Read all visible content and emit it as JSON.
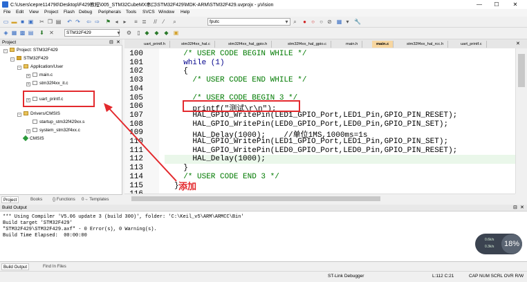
{
  "window": {
    "title": "C:\\Users\\cepre114790\\Desktop\\F429教程\\005_STM32CubeMX串口\\STM32F429\\MDK-ARM\\STM32F429.uvprojx - µVision",
    "min": "—",
    "max": "☐",
    "close": "✕"
  },
  "menu": [
    "File",
    "Edit",
    "View",
    "Project",
    "Flash",
    "Debug",
    "Peripherals",
    "Tools",
    "SVCS",
    "Window",
    "Help"
  ],
  "toolbar": {
    "find_value": "fputc",
    "target_value": "STM32F429"
  },
  "project": {
    "header": "Project",
    "root": "Project: STM32F429",
    "target": "STM32F429",
    "group_app": "Application/User",
    "files_app": [
      "main.c",
      "stm32f4xx_it.c"
    ],
    "added_file": "uart_printf.c",
    "group_drivers": "Drivers/CMSIS",
    "files_drivers": [
      "startup_stm32f429xx.s",
      "system_stm32f4xx.c"
    ],
    "cmsis": "CMSIS",
    "tabs": [
      "Project",
      "Books",
      "{} Functions",
      "0→ Templates"
    ]
  },
  "editor": {
    "tabs": [
      "uart_printf.h",
      "stm32f4xx_hal.c",
      "stm32f4xx_hal_gpio.h",
      "stm32f4xx_hal_gpio.c",
      "main.h",
      "main.c",
      "stm32f4xx_hal_rcc.h",
      "uart_printf.c"
    ],
    "active_tab": "main.c",
    "lines": [
      {
        "n": "100",
        "text": "  /* USER CODE BEGIN WHILE */",
        "cls": "cmt"
      },
      {
        "n": "101",
        "text": "  while (1)",
        "cls": "kw"
      },
      {
        "n": "102",
        "text": "  {",
        "cls": "fn"
      },
      {
        "n": "103",
        "text": "    /* USER CODE END WHILE */",
        "cls": "cmt"
      },
      {
        "n": "104",
        "text": "",
        "cls": "fn"
      },
      {
        "n": "105",
        "text": "    /* USER CODE BEGIN 3 */",
        "cls": "cmt"
      },
      {
        "n": "106",
        "text": "    printf(\"测试\\r\\n\");",
        "cls": "fn"
      },
      {
        "n": "107",
        "text": "    HAL_GPIO_WritePin(LED1_GPIO_Port,LED1_Pin,GPIO_PIN_RESET);",
        "cls": "fn"
      },
      {
        "n": "108",
        "text": "    HAL_GPIO_WritePin(LED0_GPIO_Port,LED0_Pin,GPIO_PIN_SET);",
        "cls": "fn"
      },
      {
        "n": "109",
        "text": "    HAL_Delay(1000);    //单位1MS,1000ms=1s",
        "cls": "fn"
      },
      {
        "n": "110",
        "text": "    HAL_GPIO_WritePin(LED1_GPIO_Port,LED1_Pin,GPIO_PIN_SET);",
        "cls": "fn"
      },
      {
        "n": "111",
        "text": "    HAL_GPIO_WritePin(LED0_GPIO_Port,LED0_Pin,GPIO_PIN_RESET);",
        "cls": "fn"
      },
      {
        "n": "112",
        "text": "    HAL_Delay(1000);",
        "cls": "fn"
      },
      {
        "n": "113",
        "text": "  }",
        "cls": "fn"
      },
      {
        "n": "114",
        "text": "  /* USER CODE END 3 */",
        "cls": "cmt"
      },
      {
        "n": "115",
        "text": "}",
        "cls": "fn"
      },
      {
        "n": "116",
        "text": "",
        "cls": "fn"
      }
    ],
    "annotation": "添加"
  },
  "build": {
    "header": "Build Output",
    "lines": [
      "*** Using Compiler 'V5.06 update 3 (build 300)', folder: 'C:\\Keil_v5\\ARM\\ARMCC\\Bin'",
      "Build target 'STM32F429'",
      "\"STM32F429\\STM32F429.axf\" - 0 Error(s), 0 Warning(s).",
      "Build Time Elapsed:  00:00:00"
    ],
    "tabs": [
      "Build Output",
      "Find In Files"
    ]
  },
  "status": {
    "debugger": "ST-Link Debugger",
    "position": "L:112 C:21",
    "flags": "CAP  NUM  SCRL  OVR  R/W"
  },
  "widget": {
    "up": "0.6k/s",
    "down": "0.3k/s",
    "value": "18%"
  },
  "colors": {
    "accent_red": "#e3292d",
    "comment": "#007a00",
    "keyword": "#00008b",
    "tab_active": "#f7d6a0"
  }
}
